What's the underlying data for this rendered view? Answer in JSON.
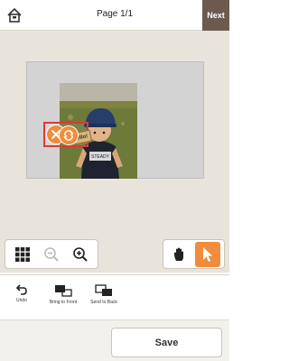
{
  "header": {
    "title": "Page 1/1",
    "next_label": "Next",
    "home_icon": "home-icon"
  },
  "canvas": {
    "sticker_text": "Hello!",
    "delete_icon": "close-icon",
    "rotate_icon": "rotate-icon"
  },
  "zoom_panel": {
    "icons": [
      "grid-icon",
      "zoom-out-icon",
      "zoom-in-icon"
    ]
  },
  "tool_panel": {
    "icons": [
      "hand-icon",
      "pointer-icon"
    ],
    "active": "pointer-icon"
  },
  "toolbar": {
    "undo_label": "Undo",
    "bring_front_label": "Bring to Front",
    "send_back_label": "Send to Back"
  },
  "save_label": "Save",
  "colors": {
    "accent": "#f08c3c",
    "next_bg": "#6b5a4d",
    "selection": "#e0373a",
    "workspace_bg": "#e8e3db"
  }
}
